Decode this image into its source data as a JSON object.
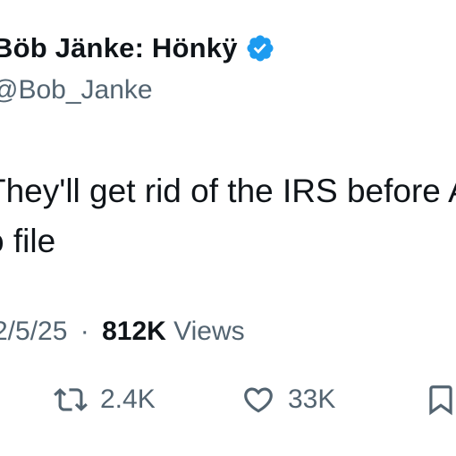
{
  "author": {
    "display_name": "Böb Jänke: Hönkÿ",
    "handle": "@Bob_Janke",
    "verified_icon": "verified-badge-icon",
    "verified_color": "#1d9bf0"
  },
  "tweet": {
    "lines": [
      "They'll get rid of the IRS before A",
      "o file"
    ]
  },
  "meta": {
    "date": "2/5/25",
    "separator": "·",
    "views_count": "812K",
    "views_label": "Views"
  },
  "actions": {
    "retweet": {
      "icon": "retweet-icon",
      "count": "2.4K"
    },
    "like": {
      "icon": "heart-icon",
      "count": "33K"
    },
    "bookmark": {
      "icon": "bookmark-icon"
    }
  },
  "colors": {
    "text_primary": "#0f1419",
    "text_secondary": "#536471"
  }
}
